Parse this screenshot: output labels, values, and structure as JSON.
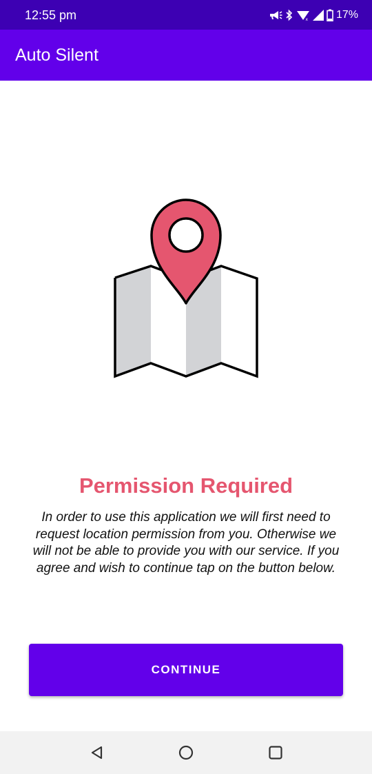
{
  "status_bar": {
    "time": "12:55 pm",
    "battery": "17%",
    "icons": [
      "megaphone-icon",
      "bluetooth-icon",
      "wifi-icon",
      "signal-icon",
      "battery-icon"
    ]
  },
  "app_bar": {
    "title": "Auto Silent"
  },
  "illustration": {
    "icon": "map-pin-icon",
    "colors": {
      "pin": "#e5566f",
      "map_light": "#ffffff",
      "map_shade": "#d2d3d6",
      "outline": "#000000"
    }
  },
  "content": {
    "title": "Permission Required",
    "message": "In order to use this application we will first need to request location permission from you. Otherwise we will not be able to provide you with our service. If you agree and wish to continue tap on the button below."
  },
  "button": {
    "label": "CONTINUE"
  },
  "nav_bar": {
    "icons": [
      "back-icon",
      "home-icon",
      "recents-icon"
    ]
  },
  "colors": {
    "status_bar": "#3d00b3",
    "app_bar": "#6200ea",
    "accent": "#e5566f",
    "button": "#6200ea"
  }
}
